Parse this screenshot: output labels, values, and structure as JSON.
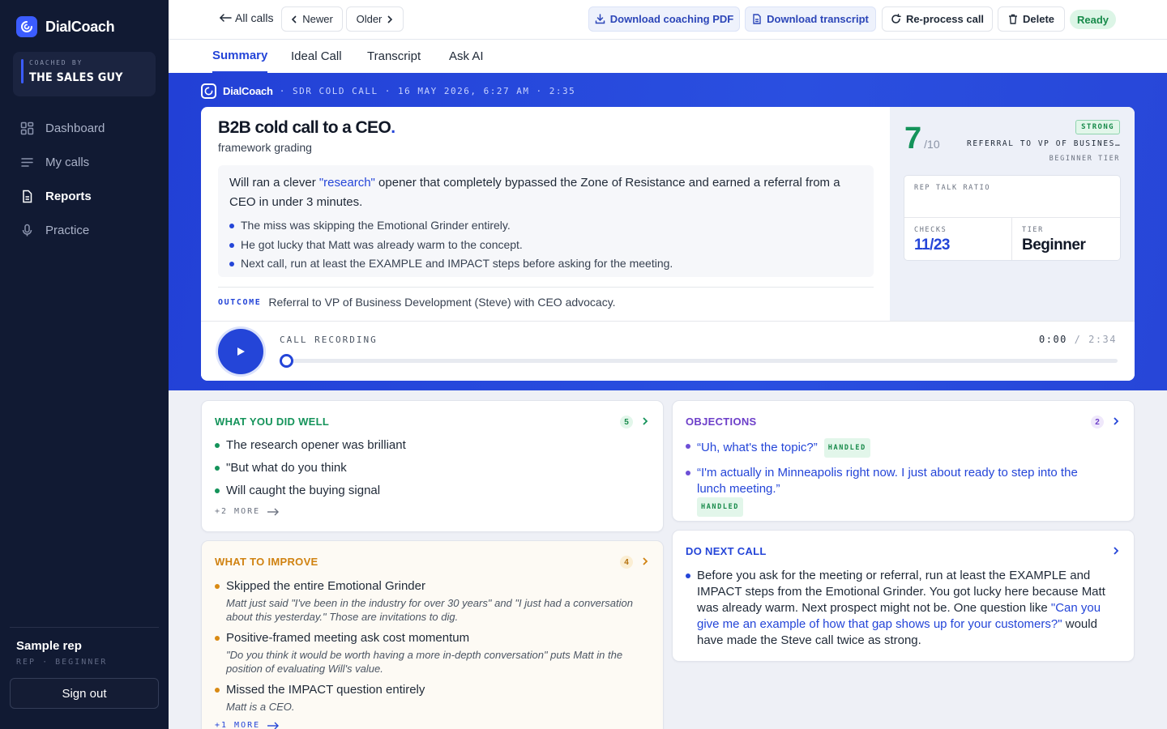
{
  "app": {
    "name": "DialCoach"
  },
  "coach": {
    "kicker": "COACHED BY",
    "name": "THE SALES GUY"
  },
  "nav": [
    {
      "label": "Dashboard",
      "icon": "grid-icon"
    },
    {
      "label": "My calls",
      "icon": "list-icon"
    },
    {
      "label": "Reports",
      "icon": "document-icon",
      "active": true
    },
    {
      "label": "Practice",
      "icon": "microphone-icon"
    }
  ],
  "user": {
    "name": "Sample rep",
    "meta": "REP · BEGINNER",
    "signout": "Sign out"
  },
  "toolbar": {
    "back": "All calls",
    "newer": "Newer",
    "older": "Older",
    "download_pdf": "Download coaching PDF",
    "download_transcript": "Download transcript",
    "reprocess": "Re-process call",
    "delete": "Delete",
    "status": "Ready"
  },
  "tabs": [
    "Summary",
    "Ideal Call",
    "Transcript",
    "Ask AI"
  ],
  "hero": {
    "brand": "DialCoach",
    "meta": "· SDR COLD CALL · 16 MAY 2026, 6:27 AM · 2:35",
    "title": "B2B cold call to a CEO",
    "title_dot": ".",
    "subtitle": "framework grading",
    "summary_pre": "Will ran a clever ",
    "summary_quote": "\"research\"",
    "summary_post": " opener that completely bypassed the Zone of Resistance and earned a referral from a CEO in under 3 minutes.",
    "bullets": [
      "The miss was skipping the Emotional Grinder entirely.",
      "He got lucky that Matt was already warm to the concept.",
      "Next call, run at least the EXAMPLE and IMPACT steps before asking for the meeting."
    ],
    "outcome_label": "OUTCOME",
    "outcome": "Referral to VP of Business Development (Steve) with CEO advocacy."
  },
  "score": {
    "value": "7",
    "denominator": "/10",
    "badge": "STRONG",
    "label": "REFERRAL TO VP OF BUSINESS DEVELOPMENT",
    "tier_line": "BEGINNER TIER",
    "talk_ratio_label": "REP TALK RATIO",
    "talk_ratio_value": "",
    "checks_label": "CHECKS",
    "checks_value": "11/23",
    "tier_label": "TIER",
    "tier_value": "Beginner"
  },
  "recording": {
    "label": "CALL RECORDING",
    "current": "0:00",
    "sep": " / ",
    "total": "2:34",
    "progress": 0
  },
  "did_well": {
    "title": "WHAT YOU DID WELL",
    "count": "5",
    "items": [
      "The research opener was brilliant",
      "\"But what do you think",
      "Will caught the buying signal"
    ],
    "more": "+2 MORE"
  },
  "objections": {
    "title": "OBJECTIONS",
    "count": "2",
    "items": [
      {
        "text": "“Uh, what's the topic?”",
        "tag": "HANDLED"
      },
      {
        "text": "“I'm actually in Minneapolis right now. I just about ready to step into the lunch meeting.”",
        "tag": "HANDLED"
      }
    ]
  },
  "improve": {
    "title": "WHAT TO IMPROVE",
    "count": "4",
    "items": [
      {
        "title": "Skipped the entire Emotional Grinder",
        "quote": "Matt just said \"I've been in the industry for over 30 years\" and \"I just had a conversation about this yesterday.\" Those are invitations to dig."
      },
      {
        "title": "Positive-framed meeting ask cost momentum",
        "quote": "\"Do you think it would be worth having a more in-depth conversation\" puts Matt in the position of evaluating Will's value."
      },
      {
        "title": "Missed the IMPACT question entirely",
        "quote": "Matt is a CEO."
      }
    ],
    "more": "+1 MORE"
  },
  "next_call": {
    "title": "DO NEXT CALL",
    "pre": "Before you ask for the meeting or referral, run at least the EXAMPLE and IMPACT steps from the Emotional Grinder. You got lucky here because Matt was already warm. Next prospect might not be. One question like ",
    "quote": "\"Can you give me an example of how that gap shows up for your customers?\"",
    "post": " would have made the Steve call twice as strong."
  },
  "colors": {
    "accent": "#2445d8",
    "sidebar": "#111a33",
    "good": "#14935a",
    "warn": "#d98a13",
    "objection": "#6d4fd6"
  }
}
